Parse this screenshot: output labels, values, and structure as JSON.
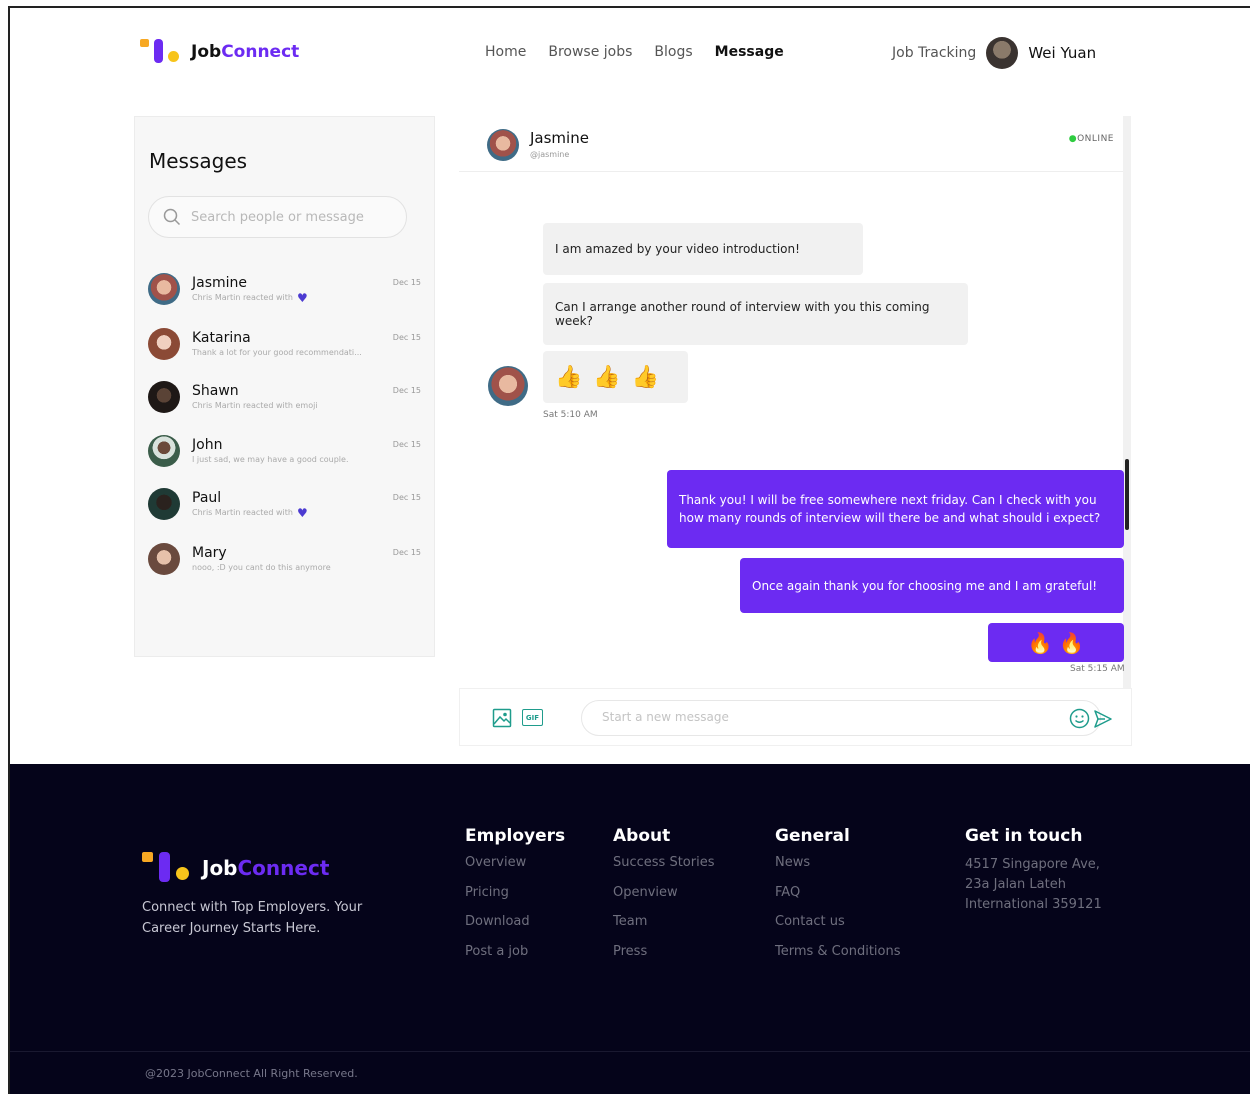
{
  "brand": {
    "name_part1": "Job",
    "name_part2": "Connect",
    "colors": {
      "purple": "#6c2bf2",
      "orange": "#f7a823",
      "yellow": "#f7c41b"
    }
  },
  "nav": {
    "items": [
      "Home",
      "Browse jobs",
      "Blogs",
      "Message"
    ],
    "active": "Message"
  },
  "header": {
    "job_tracking": "Job Tracking",
    "username": "Wei Yuan"
  },
  "messages_panel": {
    "title": "Messages",
    "search_placeholder": "Search people or message",
    "contacts": [
      {
        "name": "Jasmine",
        "preview": "Chris Martin reacted with",
        "date": "Dec 15",
        "heart": true,
        "avatar_color": "#a0524a"
      },
      {
        "name": "Katarina",
        "preview": "Thank a lot for your good recommendati...",
        "date": "Dec 15",
        "heart": false,
        "avatar_color": "#8b4a36"
      },
      {
        "name": "Shawn",
        "preview": "Chris Martin reacted with emoji",
        "date": "Dec 15",
        "heart": false,
        "avatar_color": "#2a2220"
      },
      {
        "name": "John",
        "preview": "I just sad, we may have a good couple.",
        "date": "Dec 15",
        "heart": false,
        "avatar_color": "#3b5d4a"
      },
      {
        "name": "Paul",
        "preview": "Chris Martin reacted with",
        "date": "Dec 15",
        "heart": true,
        "avatar_color": "#1f3a35"
      },
      {
        "name": "Mary",
        "preview": "nooo, :D you cant do this anymore",
        "date": "Dec 15",
        "heart": false,
        "avatar_color": "#9b6a5a"
      }
    ]
  },
  "chat": {
    "contact_name": "Jasmine",
    "contact_handle": "@jasmine",
    "status": "ONLINE",
    "incoming": [
      "I am amazed by your video introduction!",
      "Can I arrange another round of interview with you this coming week?",
      "👍 👍 👍"
    ],
    "incoming_time": "Sat 5:10 AM",
    "outgoing": [
      "Thank you! I will be free somewhere next friday. Can I check with you how many rounds of interview will there be and what should i expect?",
      "Once again thank you for choosing me and I am grateful!",
      "🔥 🔥"
    ],
    "outgoing_time": "Sat 5:15 AM",
    "composer_placeholder": "Start a new message",
    "gif_label": "GIF"
  },
  "footer": {
    "tagline": "Connect with Top Employers. Your Career Journey Starts Here.",
    "columns": [
      {
        "title": "Employers",
        "links": [
          "Overview",
          "Pricing",
          "Download",
          "Post a job"
        ]
      },
      {
        "title": "About",
        "links": [
          "Success Stories",
          "Openview",
          "Team",
          "Press"
        ]
      },
      {
        "title": "General",
        "links": [
          "News",
          "FAQ",
          "Contact us",
          "Terms & Conditions"
        ]
      }
    ],
    "contact": {
      "title": "Get in touch",
      "address": "4517 Singapore Ave, 23a Jalan Lateh International 359121"
    },
    "copyright": "@2023 JobConnect All Right Reserved."
  }
}
